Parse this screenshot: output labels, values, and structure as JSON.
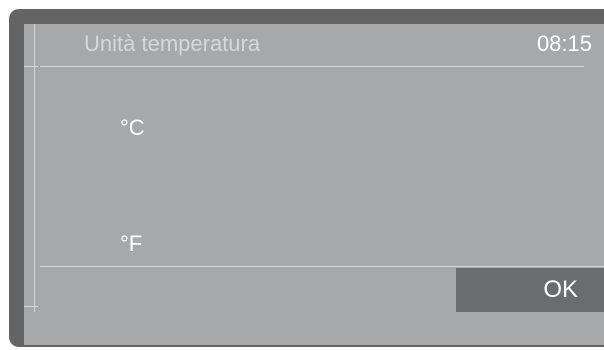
{
  "header": {
    "title": "Unità temperatura",
    "time": "08:15"
  },
  "options": [
    {
      "label": "°C"
    },
    {
      "label": "°F"
    }
  ],
  "footer": {
    "ok_label": "OK"
  },
  "colors": {
    "bezel": "#646464",
    "screen": "#a7a8aa",
    "ok_button": "#6b6c6e",
    "text": "#ffffff"
  }
}
